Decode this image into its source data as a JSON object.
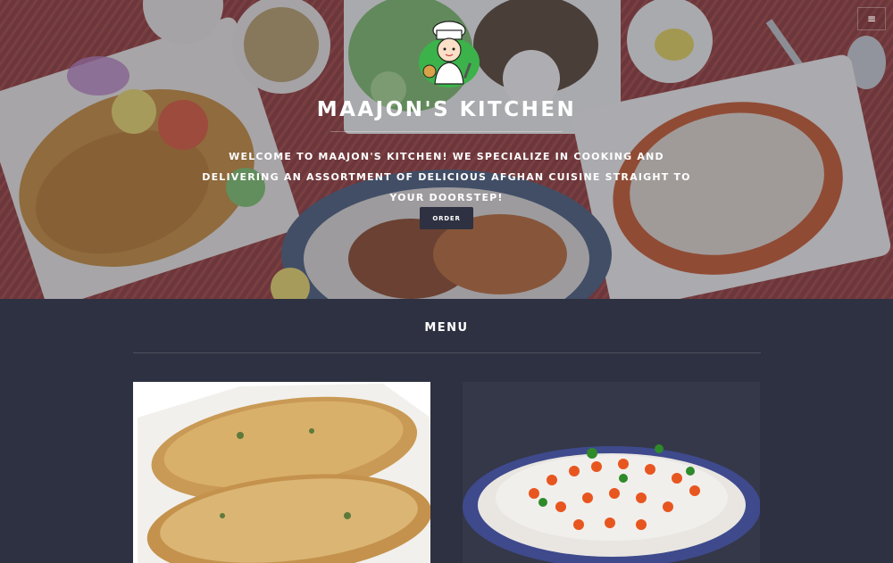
{
  "header": {
    "menu_toggle_icon": "hamburger-icon",
    "menu_toggle_glyph": "≡",
    "logo_icon": "chef-logo-icon",
    "title": "MAAJON'S KITCHEN",
    "tagline": "WELCOME TO MAAJON'S KITCHEN! WE SPECIALIZE IN COOKING AND DELIVERING AN ASSORTMENT OF DELICIOUS AFGHAN CUISINE STRAIGHT TO YOUR DOORSTEP!",
    "order_label": "ORDER"
  },
  "menu": {
    "heading": "MENU",
    "items": [
      {
        "image": "bolani-flatbread-photo"
      },
      {
        "image": "mantu-dumplings-photo"
      }
    ]
  },
  "colors": {
    "background": "#2e3141",
    "hero_tint": "#7a3236",
    "text": "#ffffff",
    "card_dark": "#353849"
  }
}
